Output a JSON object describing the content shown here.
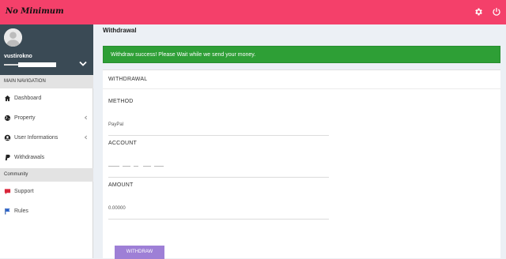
{
  "topbar": {
    "brand": "No Minimum",
    "icons": [
      "gear-icon",
      "power-icon"
    ],
    "color": "#f4406a"
  },
  "sidebar": {
    "user": {
      "name": "vustirokno"
    },
    "main_nav_header": "MAIN NAVIGATION",
    "items": [
      {
        "label": "Dashboard",
        "icon": "home-icon"
      },
      {
        "label": "Property",
        "icon": "globe-icon",
        "has_submenu": true
      },
      {
        "label": "User Informations",
        "icon": "user-circle-icon",
        "has_submenu": true
      },
      {
        "label": "Withdrawals",
        "icon": "paypal-icon"
      }
    ],
    "community_header": "Community",
    "community_items": [
      {
        "label": "Support",
        "icon": "chat-icon"
      },
      {
        "label": "Rules",
        "icon": "flag-icon"
      }
    ]
  },
  "main": {
    "title": "Withdrawal",
    "alert": {
      "text": "Withdraw success! Please Wait while we send your money.",
      "color": "#2e9f36"
    },
    "form": {
      "header": "WITHDRAWAL",
      "method_label": "METHOD",
      "method_value": "PayPal",
      "account_label": "ACCOUNT",
      "amount_label": "AMOUNT",
      "amount_value": "0.00000",
      "submit_label": "WITHDRAW",
      "button_color": "#9e7fd6"
    }
  }
}
